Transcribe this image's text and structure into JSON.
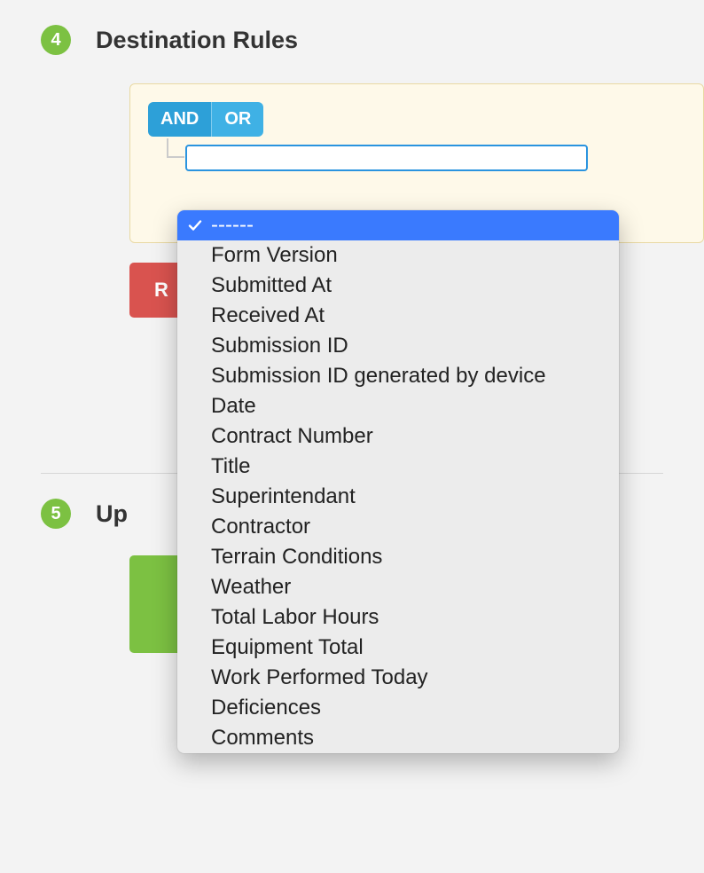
{
  "section4": {
    "step": "4",
    "title": "Destination Rules",
    "toggle": {
      "and": "AND",
      "or": "OR"
    },
    "remove_button": "R"
  },
  "section5": {
    "step": "5",
    "title": "Up"
  },
  "dropdown": {
    "selected_index": 0,
    "options": [
      "------",
      "Form Version",
      "Submitted At",
      "Received At",
      "Submission ID",
      "Submission ID generated by device",
      "Date",
      "Contract Number",
      "Title",
      "Superintendant",
      "Contractor",
      "Terrain Conditions",
      "Weather",
      "Total Labor Hours",
      "Equipment Total",
      "Work Performed Today",
      "Deficiences",
      "Comments"
    ]
  }
}
